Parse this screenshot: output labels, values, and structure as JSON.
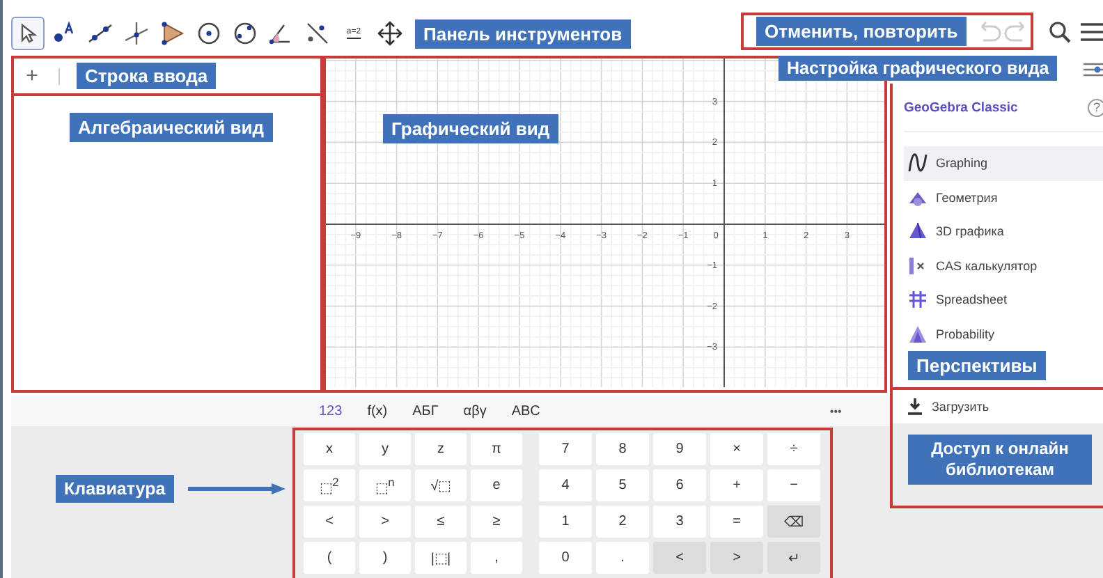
{
  "toolbar": {
    "tools": [
      {
        "kind": "move",
        "selected": true
      },
      {
        "kind": "point",
        "selected": false
      },
      {
        "kind": "segment",
        "selected": false
      },
      {
        "kind": "perpendicular",
        "selected": false
      },
      {
        "kind": "polygon",
        "selected": false
      },
      {
        "kind": "circle-center",
        "selected": false
      },
      {
        "kind": "circle-points",
        "selected": false
      },
      {
        "kind": "angle",
        "selected": false
      },
      {
        "kind": "reflect",
        "selected": false
      },
      {
        "kind": "slider",
        "label": "a=2",
        "selected": false
      },
      {
        "kind": "move-view",
        "selected": false
      }
    ],
    "callout": "Панель инструментов"
  },
  "undo_redo": {
    "callout": "Отменить, повторить"
  },
  "graphics_settings": {
    "callout": "Настройка графического вида"
  },
  "input_bar": {
    "add_button": "+",
    "callout": "Строка ввода"
  },
  "algebra_view": {
    "callout": "Алгебраический вид"
  },
  "graphics_view": {
    "callout": "Графический вид",
    "x_ticks": [
      "−9",
      "−8",
      "−7",
      "−6",
      "−5",
      "−4",
      "−3",
      "−2",
      "−1",
      "0",
      "1",
      "2",
      "3"
    ],
    "y_ticks": [
      "3",
      "2",
      "1",
      "−1",
      "−2",
      "−3"
    ]
  },
  "perspectives_menu": {
    "title": "GeoGebra Classic",
    "help": "?",
    "items": [
      {
        "kind": "graphing",
        "label": "Graphing",
        "selected": true
      },
      {
        "kind": "geometry",
        "label": "Геометрия",
        "selected": false
      },
      {
        "kind": "solid",
        "label": "3D графика",
        "selected": false
      },
      {
        "kind": "cas",
        "label": "CAS калькулятор",
        "selected": false
      },
      {
        "kind": "spreadsheet",
        "label": "Spreadsheet",
        "selected": false
      },
      {
        "kind": "probability",
        "label": "Probability",
        "selected": false
      }
    ],
    "callout": "Перспективы",
    "download": "Загрузить",
    "library_callout": "Доступ к онлайн библиотекам"
  },
  "keyboard": {
    "tabs": [
      {
        "label": "123",
        "selected": true
      },
      {
        "label": "f(x)",
        "selected": false
      },
      {
        "label": "АБГ",
        "selected": false
      },
      {
        "label": "αβγ",
        "selected": false
      },
      {
        "label": "ABC",
        "selected": false
      }
    ],
    "more": "•••",
    "callout": "Клавиатура",
    "letter_pad": [
      [
        {
          "label": "x",
          "kind": "char"
        },
        {
          "label": "y",
          "kind": "char"
        },
        {
          "label": "z",
          "kind": "char"
        },
        {
          "label": "π",
          "kind": "char"
        }
      ],
      [
        {
          "label": "⬚$^{2}$",
          "kind": "char"
        },
        {
          "label": "⬚$^{n}$",
          "kind": "char"
        },
        {
          "label": "√⬚",
          "kind": "char"
        },
        {
          "label": "e",
          "kind": "char"
        }
      ],
      [
        {
          "label": "<",
          "kind": "char"
        },
        {
          "label": ">",
          "kind": "char"
        },
        {
          "label": "≤",
          "kind": "char"
        },
        {
          "label": "≥",
          "kind": "char"
        }
      ],
      [
        {
          "label": "(",
          "kind": "char"
        },
        {
          "label": ")",
          "kind": "char"
        },
        {
          "label": "|⬚|",
          "kind": "char"
        },
        {
          "label": ",",
          "kind": "char"
        }
      ]
    ],
    "number_pad": [
      [
        {
          "label": "7",
          "kind": "char"
        },
        {
          "label": "8",
          "kind": "char"
        },
        {
          "label": "9",
          "kind": "char"
        },
        {
          "label": "×",
          "kind": "char"
        },
        {
          "label": "÷",
          "kind": "char"
        }
      ],
      [
        {
          "label": "4",
          "kind": "char"
        },
        {
          "label": "5",
          "kind": "char"
        },
        {
          "label": "6",
          "kind": "char"
        },
        {
          "label": "+",
          "kind": "char"
        },
        {
          "label": "−",
          "kind": "char"
        }
      ],
      [
        {
          "label": "1",
          "kind": "char"
        },
        {
          "label": "2",
          "kind": "char"
        },
        {
          "label": "3",
          "kind": "char"
        },
        {
          "label": "=",
          "kind": "char"
        },
        {
          "label": "⌫",
          "kind": "action"
        }
      ],
      [
        {
          "label": "0",
          "kind": "char"
        },
        {
          "label": ".",
          "kind": "char"
        },
        {
          "label": "<",
          "kind": "action"
        },
        {
          "label": ">",
          "kind": "action"
        },
        {
          "label": "↵",
          "kind": "action"
        }
      ]
    ]
  }
}
